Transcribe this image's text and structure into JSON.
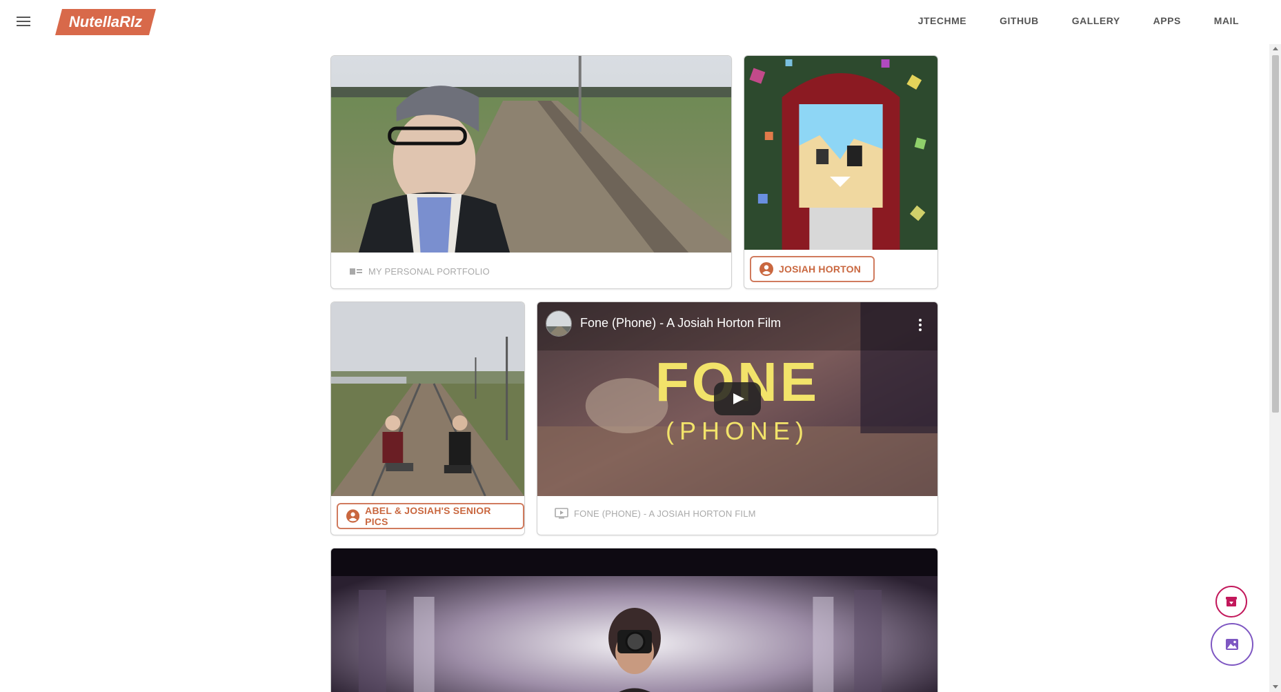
{
  "header": {
    "logo_text": "NutellaRlz",
    "nav": [
      "JTECHME",
      "GITHUB",
      "GALLERY",
      "APPS",
      "MAIL"
    ]
  },
  "cards": {
    "portfolio": {
      "caption": "MY PERSONAL PORTFOLIO"
    },
    "josiah": {
      "chip_label": "JOSIAH HORTON"
    },
    "senior": {
      "chip_label": "ABEL & JOSIAH'S SENIOR PICS"
    },
    "video": {
      "title": "Fone (Phone) - A Josiah Horton Film",
      "big_title": "FONE",
      "sub_title": "(PHONE)",
      "caption": "FONE (PHONE) - A JOSIAH HORTON FILM"
    }
  },
  "icons": {
    "menu": "hamburger-icon",
    "portfolio": "contact-card-icon",
    "person": "account-circle-icon",
    "tv": "tv-icon",
    "play": "play-icon",
    "more": "more-vert-icon",
    "fab_top": "archive-icon",
    "fab_bottom": "image-icon"
  },
  "colors": {
    "accent": "#d8694a",
    "chip_text": "#c9673f",
    "fab_top": "#c2185b",
    "fab_bottom": "#7e57c2"
  }
}
